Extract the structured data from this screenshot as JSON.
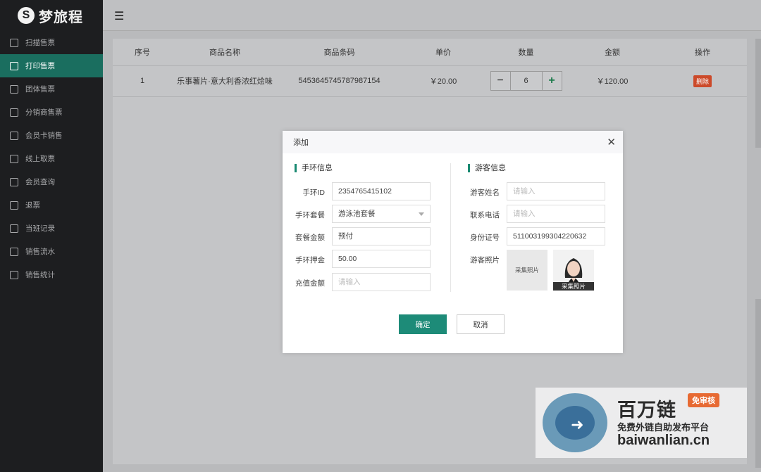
{
  "app": {
    "logo_text": "梦旅程",
    "logo_mark": "S"
  },
  "sidebar": {
    "items": [
      {
        "label": "扫描售票",
        "icon": "scan-icon"
      },
      {
        "label": "打印售票",
        "icon": "printer-icon",
        "active": true
      },
      {
        "label": "团体售票",
        "icon": "group-icon"
      },
      {
        "label": "分销商售票",
        "icon": "distributor-icon"
      },
      {
        "label": "会员卡销售",
        "icon": "card-icon"
      },
      {
        "label": "线上取票",
        "icon": "ticket-icon"
      },
      {
        "label": "会员查询",
        "icon": "member-search-icon"
      },
      {
        "label": "退票",
        "icon": "refund-icon"
      },
      {
        "label": "当班记录",
        "icon": "record-icon"
      },
      {
        "label": "销售流水",
        "icon": "sales-flow-icon"
      },
      {
        "label": "销售统计",
        "icon": "sales-stats-icon"
      }
    ]
  },
  "header": {
    "menu_icon": "☰"
  },
  "table": {
    "columns": [
      "序号",
      "商品名称",
      "商品条码",
      "单价",
      "数量",
      "金额",
      "操作"
    ],
    "rows": [
      {
        "index": "1",
        "name": "乐事薯片·意大利香浓红烩味",
        "barcode": "5453645745787987154",
        "price": "￥20.00",
        "quantity": "6",
        "amount": "￥120.00",
        "action": "删除"
      }
    ],
    "minus": "−",
    "plus": "+"
  },
  "dialog": {
    "title": "添加",
    "close": "✕",
    "left_title": "手环信息",
    "right_title": "游客信息",
    "fields_left": [
      {
        "label": "手环ID",
        "value": "2354765415102",
        "placeholder": ""
      },
      {
        "label": "手环套餐",
        "value": "游泳池套餐",
        "placeholder": ""
      },
      {
        "label": "套餐金额",
        "value": "预付",
        "placeholder": ""
      },
      {
        "label": "手环押金",
        "value": "50.00",
        "placeholder": ""
      },
      {
        "label": "充值金额",
        "value": "",
        "placeholder": "请输入"
      }
    ],
    "fields_right": [
      {
        "label": "游客姓名",
        "value": "",
        "placeholder": "请输入"
      },
      {
        "label": "联系电话",
        "value": "",
        "placeholder": "请输入"
      },
      {
        "label": "身份证号",
        "value": "511003199304220632",
        "placeholder": ""
      }
    ],
    "photo_label": "游客照片",
    "photo_placeholder": "采集照片",
    "photo_caption": "采集照片",
    "confirm": "确定",
    "cancel": "取消"
  },
  "watermark": {
    "title": "百万链",
    "tag": "免审核",
    "subtitle": "免费外链自助发布平台",
    "url": "baiwanlian.cn"
  }
}
